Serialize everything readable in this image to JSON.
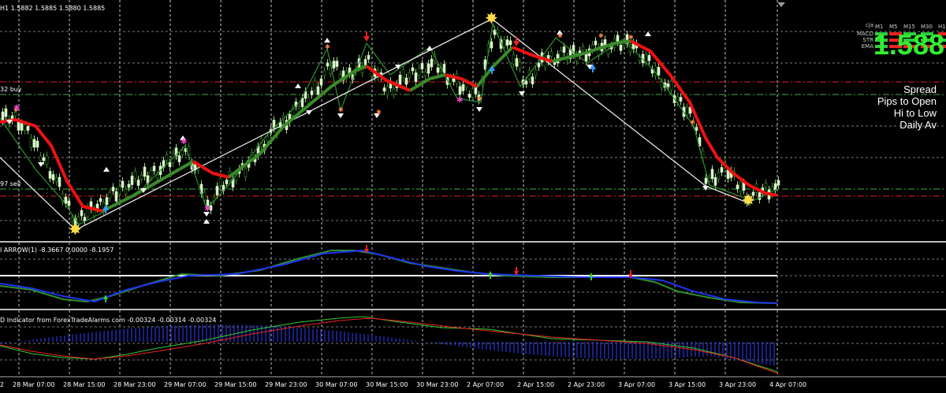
{
  "main": {
    "header": "H1  1.5882 1.5885 1.5880 1.5885",
    "buy_label": "32 buy",
    "sell_label": "97 sell"
  },
  "indicator1": {
    "label": "I ARROW(1) -8.3667 0.0000 -8.1957"
  },
  "indicator2": {
    "label": "D Indicator from ForexTradeAlarms com -0.00324 -0.00314 -0.00324"
  },
  "dashboard": {
    "pair_short": "cja",
    "timeframes": [
      "M1",
      "M5",
      "M15",
      "M30",
      "H1"
    ],
    "rows": [
      {
        "name": "MACD",
        "colors": [
          "#2ecc40",
          "#ee2222",
          "#2ecc40",
          "#2ecc40",
          "#ee2222"
        ]
      },
      {
        "name": "STR",
        "colors": [
          "#2ecc40",
          "#ee2222",
          "#2ecc40",
          "#2ecc40",
          "#2ecc40"
        ]
      },
      {
        "name": "EMA",
        "colors": [
          "#2ecc40",
          "#ee2222",
          "#ee2222",
          "#ee2222",
          "#ee2222"
        ]
      }
    ],
    "price": "1.588",
    "spread_label": "Spread",
    "pips_label": "Pips to Open",
    "hilo_label": "Hi to Low",
    "daily_label": "Daily Av"
  },
  "x_axis": [
    "2",
    "28 Mar 07:00",
    "28 Mar 15:00",
    "28 Mar 23:00",
    "29 Mar 07:00",
    "29 Mar 15:00",
    "29 Mar 23:00",
    "30 Mar 07:00",
    "30 Mar 15:00",
    "30 Mar 23:00",
    "2 Apr 07:00",
    "2 Apr 15:00",
    "2 Apr 23:00",
    "3 Apr 07:00",
    "3 Apr 15:00",
    "3 Apr 23:00",
    "4 Apr 07:00"
  ],
  "colors": {
    "bull": "#d8f5c8",
    "ema_up": "#3a8a2a",
    "ema_down": "#ee1111",
    "zigzag": "#e6e6e6",
    "level_red": "#dd2222",
    "level_green": "#44aa44",
    "blue": "#1e33ee",
    "green_line": "#2f8f2f",
    "hist": "#2233cc"
  }
}
